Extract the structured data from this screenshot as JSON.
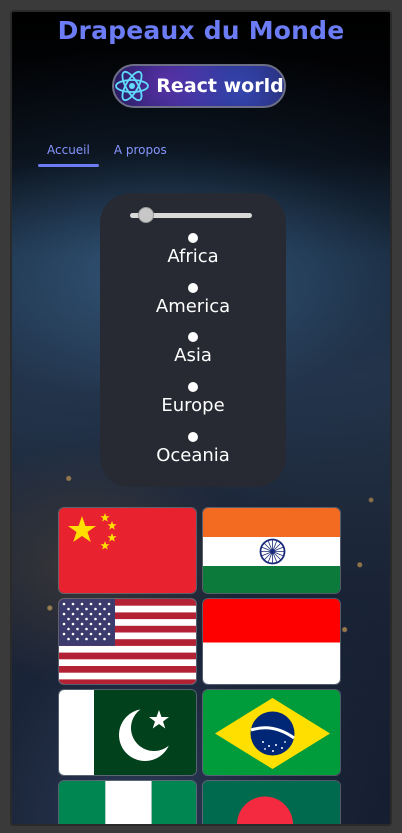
{
  "header": {
    "title": "Drapeaux du Monde"
  },
  "logo_button": {
    "label": "React world",
    "icon": "react-atom-icon"
  },
  "nav": {
    "tabs": [
      {
        "label": "Accueil",
        "active": true
      },
      {
        "label": "A propos",
        "active": false
      }
    ]
  },
  "filter": {
    "slider_value": 0.1,
    "regions": [
      "Africa",
      "America",
      "Asia",
      "Europe",
      "Oceania"
    ]
  },
  "flags": [
    "china-flag",
    "india-flag",
    "usa-flag",
    "indonesia-flag",
    "pakistan-flag",
    "brazil-flag",
    "nigeria-flag",
    "bangladesh-flag"
  ],
  "colors": {
    "accent": "#6b7cf4",
    "panel": "#272a33"
  }
}
